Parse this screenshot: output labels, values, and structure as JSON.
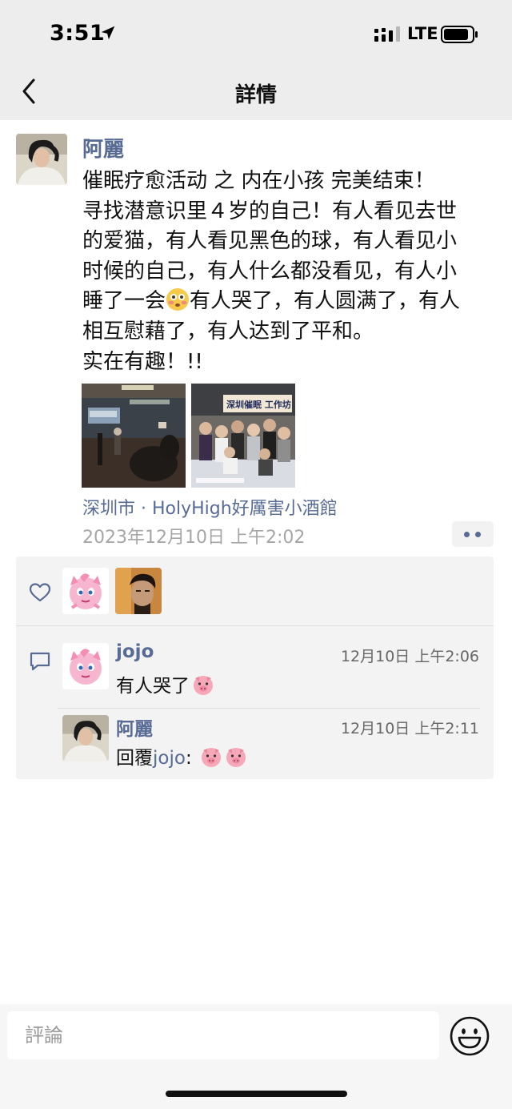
{
  "status_bar": {
    "time": "3:51",
    "network": "LTE"
  },
  "nav": {
    "title": "詳情"
  },
  "post": {
    "author": "阿麗",
    "lines": [
      "催眠疗愈活动 之 内在小孩 完美结束！",
      "寻找潜意识里４岁的自己！有人看见去世",
      "的爱猫，有人看见黑色的球，有人看见小",
      "时候的自己，有人什么都没看见，有人小"
    ],
    "line5_before": "睡了一会",
    "line5_after": "有人哭了，有人圆满了，有人",
    "line6": "相互慰藉了，有人达到了平和。",
    "line7": "实在有趣！!!",
    "photo2_banner": "深圳催眠 工作坊",
    "location": "深圳市 · HolyHigh好厲害小酒館",
    "time": "2023年12月10日 上午2:02"
  },
  "comments": [
    {
      "name": "jojo",
      "time": "12月10日 上午2:06",
      "text": "有人哭了"
    },
    {
      "name": "阿麗",
      "time": "12月10日 上午2:11",
      "reply_prefix": "回覆",
      "reply_to": "jojo",
      "reply_suffix": ":"
    }
  ],
  "comment_bar": {
    "placeholder": "評論"
  },
  "colors": {
    "link": "#576b95",
    "nav_bg": "#ededed",
    "panel_bg": "#f3f3f3"
  },
  "icons": [
    "location-arrow-icon",
    "signal-icon",
    "battery-icon",
    "back-chevron-icon",
    "flushed-face-emoji",
    "heart-outline-icon",
    "comment-bubble-icon",
    "pig-emoji",
    "smiley-face-icon"
  ]
}
